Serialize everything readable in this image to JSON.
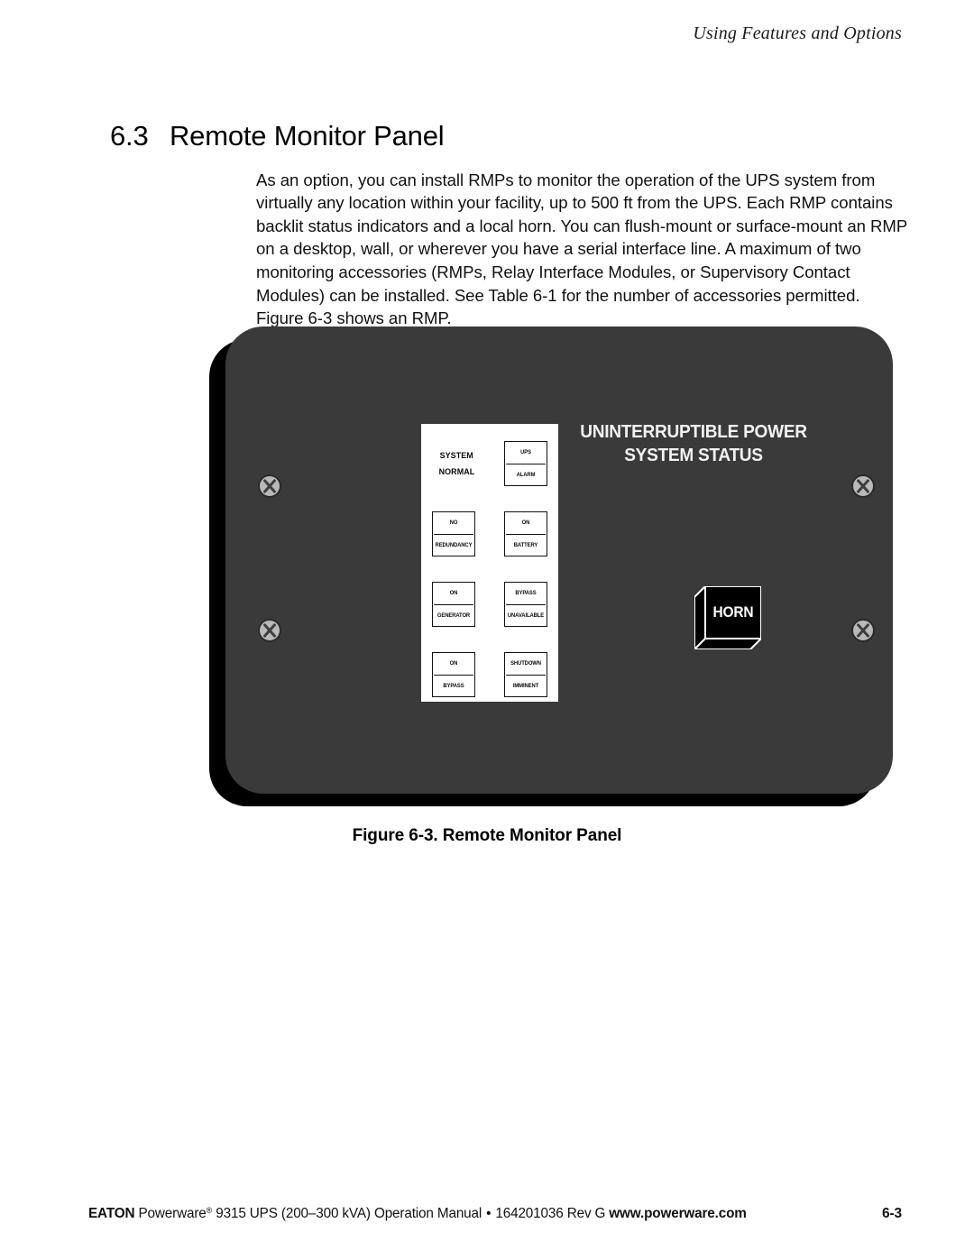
{
  "header": {
    "running_head": "Using Features and Options"
  },
  "section": {
    "number": "6.3",
    "title": "Remote Monitor Panel"
  },
  "body": {
    "paragraph": "As an option, you can install RMPs to monitor the operation of the UPS system from virtually any location within your facility, up to 500 ft from the UPS. Each RMP contains backlit status indicators and a local horn. You can flush-mount or surface-mount an RMP on a desktop, wall, or wherever you have a serial interface line. A maximum of two monitoring accessories (RMPs, Relay Interface Modules, or Supervisory Contact Modules) can be installed. See Table 6-1 for the number of accessories permitted. Figure 6-3 shows an RMP."
  },
  "figure": {
    "caption": "Figure 6-3. Remote Monitor Panel",
    "panel": {
      "status_title_line1": "UNINTERRUPTIBLE POWER",
      "status_title_line2": "SYSTEM STATUS",
      "horn_label": "HORN",
      "indicators": [
        {
          "left": {
            "boxed": false,
            "line1": "SYSTEM",
            "line2": "NORMAL"
          },
          "right": {
            "boxed": true,
            "line1": "UPS",
            "line2": "ALARM"
          }
        },
        {
          "left": {
            "boxed": true,
            "line1": "NO",
            "line2": "REDUNDANCY"
          },
          "right": {
            "boxed": true,
            "line1": "ON",
            "line2": "BATTERY"
          }
        },
        {
          "left": {
            "boxed": true,
            "line1": "ON",
            "line2": "GENERATOR"
          },
          "right": {
            "boxed": true,
            "line1": "BYPASS",
            "line2": "UNAVAILABLE"
          }
        },
        {
          "left": {
            "boxed": true,
            "line1": "ON",
            "line2": "BYPASS"
          },
          "right": {
            "boxed": true,
            "line1": "SHUTDOWN",
            "line2": "IMMINENT"
          }
        }
      ],
      "colors": {
        "panel_face": "#3a3a3a",
        "panel_shadow": "#000000",
        "label_area": "#ffffff",
        "screw_head": "#b9b9b9",
        "title_text": "#f2f2f2"
      }
    }
  },
  "footer": {
    "brand": "EATON",
    "text_before_url": "Powerware",
    "registered_mark": "®",
    "product": " 9315 UPS (200–300 kVA) Operation Manual",
    "separator": "•",
    "doc_number": "164201036 Rev G",
    "url": "www.powerware.com",
    "page_number": "6-3"
  }
}
